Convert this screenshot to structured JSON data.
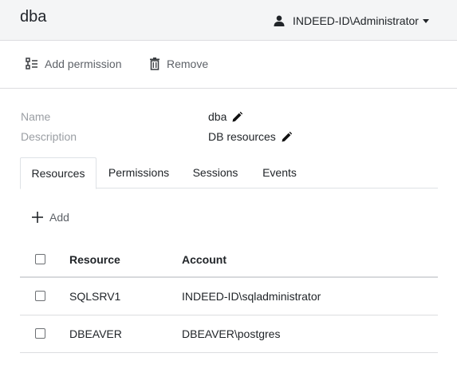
{
  "header": {
    "title": "dba",
    "user": "INDEED-ID\\Administrator"
  },
  "toolbar": {
    "add_permission": "Add permission",
    "remove": "Remove"
  },
  "properties": {
    "name_label": "Name",
    "name_value": "dba",
    "description_label": "Description",
    "description_value": "DB resources"
  },
  "tabs": [
    {
      "label": "Resources",
      "active": true
    },
    {
      "label": "Permissions",
      "active": false
    },
    {
      "label": "Sessions",
      "active": false
    },
    {
      "label": "Events",
      "active": false
    }
  ],
  "resources": {
    "add_label": "Add",
    "columns": {
      "resource": "Resource",
      "account": "Account"
    },
    "rows": [
      {
        "resource": "SQLSRV1",
        "account": "INDEED-ID\\sqladministrator",
        "checked": false
      },
      {
        "resource": "DBEAVER",
        "account": "DBEAVER\\postgres",
        "checked": false
      }
    ]
  },
  "icons": {
    "user": "user-icon",
    "add_permission": "list-add-icon",
    "remove": "trash-icon",
    "edit": "pencil-icon",
    "add": "plus-icon",
    "dropdown": "caret-down-icon"
  }
}
